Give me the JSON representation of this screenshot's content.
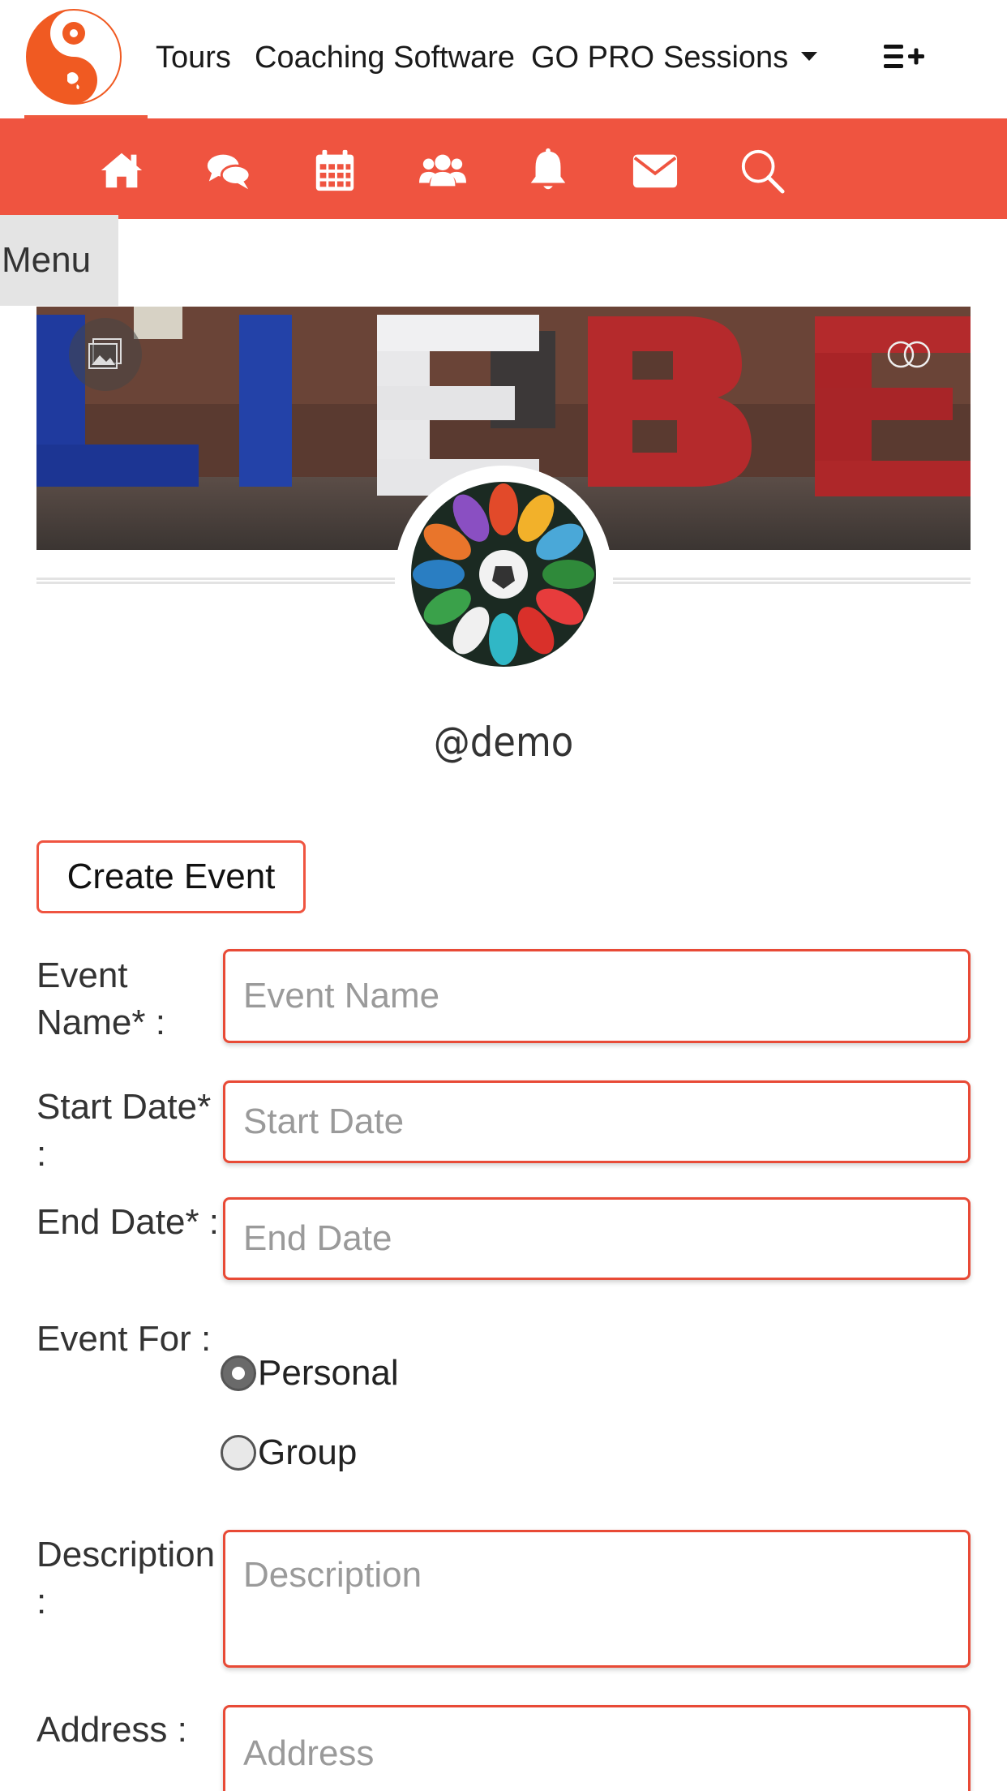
{
  "nav": {
    "links": [
      "Tours",
      "Coaching Software",
      "GO PRO",
      "Sessions"
    ]
  },
  "iconbar": {
    "icons": [
      "home-icon",
      "chat-icon",
      "calendar-icon",
      "users-icon",
      "bell-icon",
      "envelope-icon",
      "search-icon"
    ],
    "bg_color": "#ef5440"
  },
  "menu_tab": "Menu",
  "profile": {
    "username": "@demo"
  },
  "form": {
    "create_button": "Create Event",
    "event_name": {
      "label": "Event Name* :",
      "placeholder": "Event Name"
    },
    "start_date": {
      "label": "Start Date* :",
      "placeholder": "Start Date"
    },
    "end_date": {
      "label": "End Date* :",
      "placeholder": "End Date"
    },
    "event_for": {
      "label": "Event For :",
      "options": [
        "Personal",
        "Group"
      ],
      "selected": "Personal"
    },
    "description": {
      "label": "Description :",
      "placeholder": "Description"
    },
    "address": {
      "label": "Address :",
      "placeholder": "Address"
    }
  },
  "colors": {
    "accent": "#ef5440",
    "logo": "#f05a22"
  }
}
